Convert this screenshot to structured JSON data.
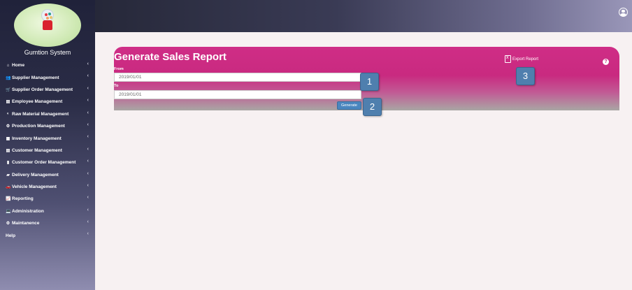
{
  "app": {
    "brand": "Gumtion System"
  },
  "sidebar": {
    "items": [
      {
        "icon": "⌂",
        "label": "Home"
      },
      {
        "icon": "👥",
        "label": "Supplier Management"
      },
      {
        "icon": "🛒",
        "label": "Supplier Order Management"
      },
      {
        "icon": "▤",
        "label": "Employee Management"
      },
      {
        "icon": "◐",
        "label": "Raw Material Management"
      },
      {
        "icon": "⚙",
        "label": "Production Management"
      },
      {
        "icon": "▦",
        "label": "Inventory Management"
      },
      {
        "icon": "▤",
        "label": "Customer Management"
      },
      {
        "icon": "▮",
        "label": "Customer Order Management"
      },
      {
        "icon": "▰",
        "label": "Delivery Management"
      },
      {
        "icon": "🚗",
        "label": "Vehicle Management"
      },
      {
        "icon": "📈",
        "label": "Reporting"
      },
      {
        "icon": "💻",
        "label": "Administration"
      },
      {
        "icon": "⚙",
        "label": "Maintanence"
      },
      {
        "icon": "",
        "label": "Help"
      }
    ]
  },
  "report": {
    "title": "Generate Sales Report",
    "from_label": "From",
    "from_value": "2019/01/01",
    "to_label": "To",
    "to_value": "2019/01/01",
    "generate_label": "Generate",
    "export_label": "Export Report",
    "help_symbol": "?"
  },
  "annotations": {
    "badge_1": "1",
    "badge_2": "2",
    "badge_3": "3"
  },
  "colors": {
    "card": "#cf2d86",
    "sidebar_top": "#20223a",
    "badge": "#4f7fae",
    "button": "#4a86bf"
  }
}
